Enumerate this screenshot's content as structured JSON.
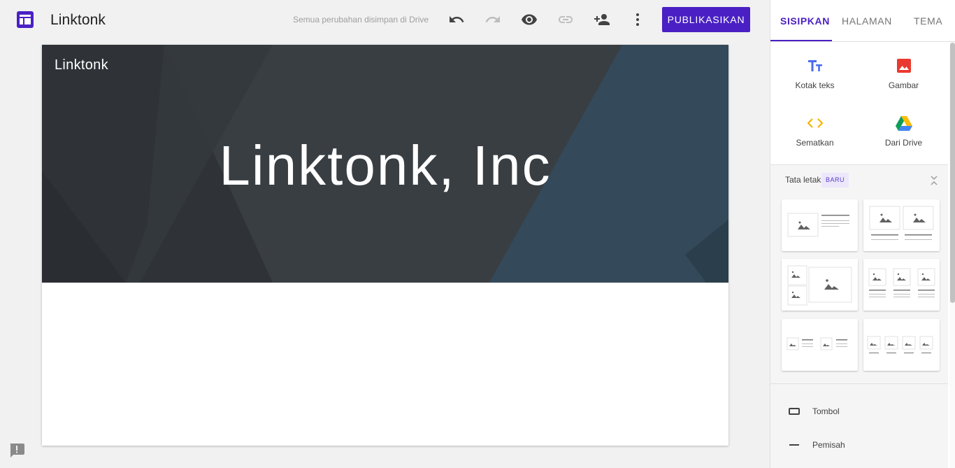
{
  "header": {
    "site_name": "Linktonk",
    "save_status": "Semua perubahan disimpan di Drive",
    "publish_label": "PUBLIKASIKAN",
    "icons": [
      "sites-logo-icon",
      "undo-icon",
      "redo-icon",
      "preview-eye-icon",
      "link-icon",
      "share-person-add-icon",
      "more-vert-icon"
    ]
  },
  "canvas": {
    "brand": "Linktonk",
    "hero_title": "Linktonk, Inc"
  },
  "panel": {
    "tabs": [
      {
        "label": "SISIPKAN",
        "active": true
      },
      {
        "label": "HALAMAN",
        "active": false
      },
      {
        "label": "TEMA",
        "active": false
      }
    ],
    "insert_items": [
      {
        "label": "Kotak teks",
        "icon": "text-box-icon"
      },
      {
        "label": "Gambar",
        "icon": "image-icon"
      },
      {
        "label": "Sematkan",
        "icon": "embed-code-icon"
      },
      {
        "label": "Dari Drive",
        "icon": "google-drive-icon"
      }
    ],
    "layouts": {
      "title": "Tata letak",
      "badge": "BARU"
    },
    "elements": [
      {
        "label": "Tombol",
        "icon": "button-icon"
      },
      {
        "label": "Pemisah",
        "icon": "divider-icon"
      }
    ]
  },
  "colors": {
    "accent": "#4a20c4",
    "hero_bg": "#383d42",
    "image_icon": "#ea3a2f",
    "embed_icon": "#f6b400"
  }
}
